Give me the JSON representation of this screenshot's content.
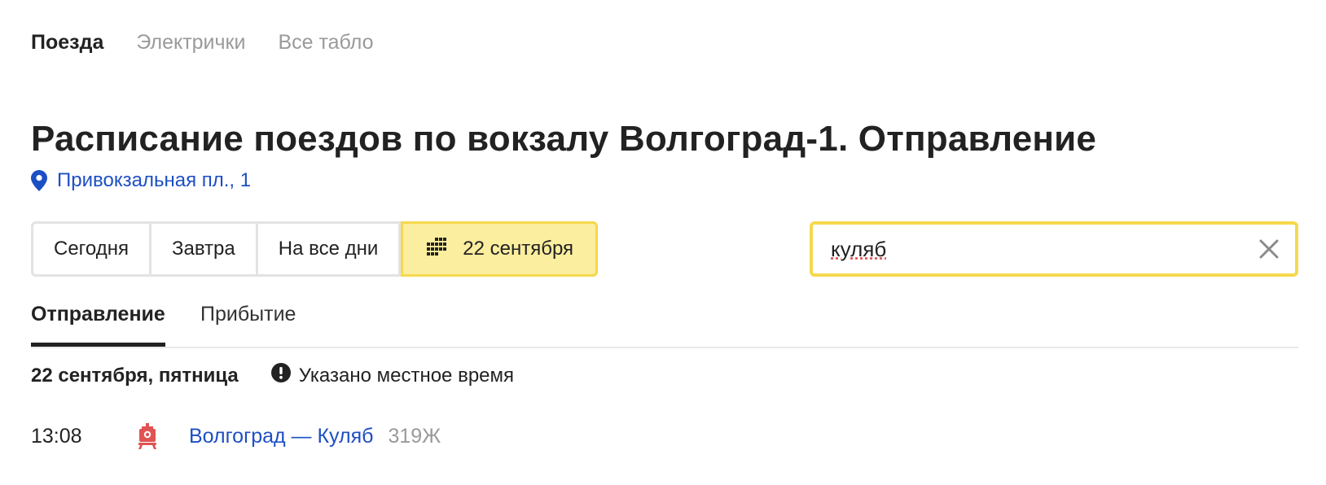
{
  "topnav": {
    "trains": "Поезда",
    "suburban": "Электрички",
    "all_boards": "Все табло"
  },
  "page_title": "Расписание поездов по вокзалу Волгоград-1. Отправление",
  "address": "Привокзальная пл., 1",
  "day_filters": {
    "today": "Сегодня",
    "tomorrow": "Завтра",
    "all_days": "На все дни",
    "selected_date": "22 сентября"
  },
  "search": {
    "value": "куляб"
  },
  "tabs": {
    "departure": "Отправление",
    "arrival": "Прибытие"
  },
  "date_header": "22 сентября, пятница",
  "time_note": "Указано местное время",
  "trains": [
    {
      "time": "13:08",
      "route": "Волгоград — Куляб",
      "number": "319Ж"
    }
  ],
  "colors": {
    "accent_yellow": "#fcee9f",
    "accent_border": "#f6d84d",
    "link_blue": "#1d4fc4",
    "train_icon": "#e05353"
  },
  "icons": {
    "address": "location-pin-icon",
    "calendar": "calendar-grid-icon",
    "clear": "close-icon",
    "note": "exclamation-circle-icon",
    "train": "locomotive-icon"
  }
}
